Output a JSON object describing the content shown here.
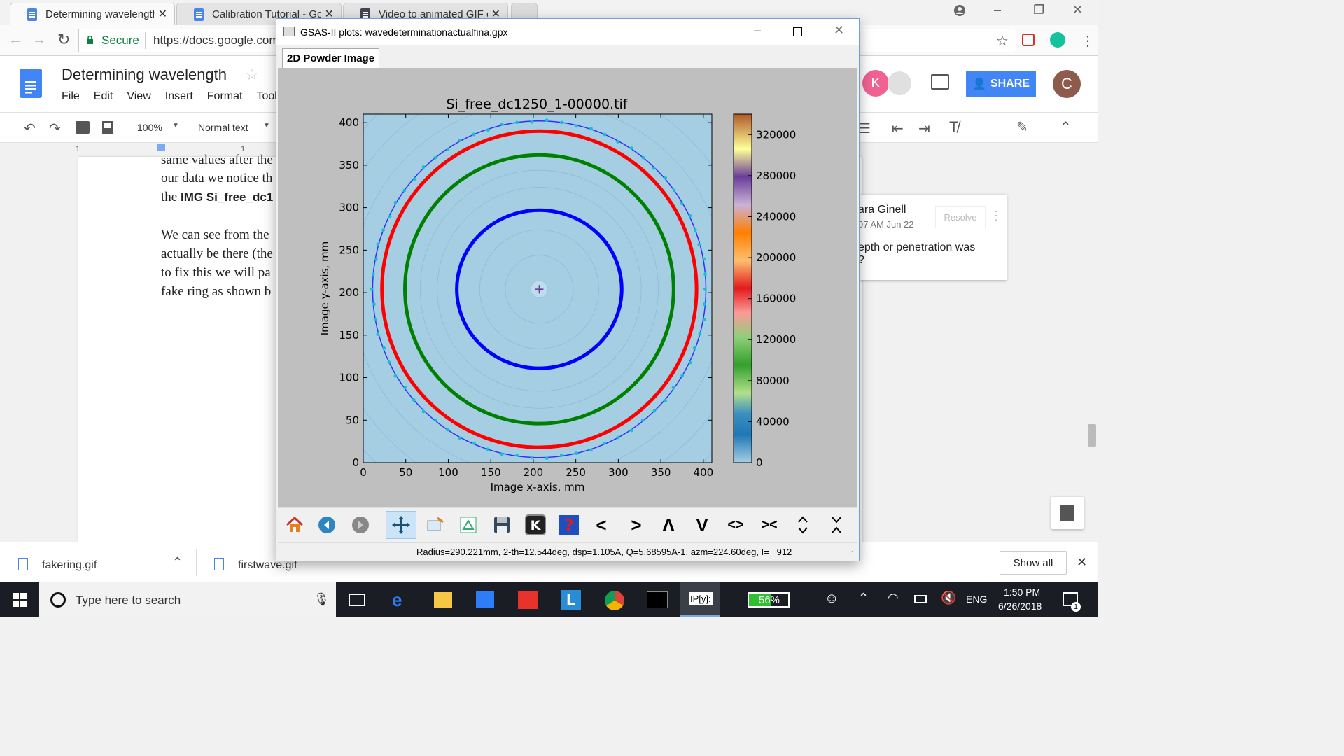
{
  "browser": {
    "tabs": [
      {
        "title": "Determining wavelength",
        "active": true
      },
      {
        "title": "Calibration Tutorial - Goo",
        "active": false
      },
      {
        "title": "Video to animated GIF co",
        "active": false
      }
    ],
    "secure_label": "Secure",
    "url": "https://docs.google.com"
  },
  "docs": {
    "doc_title": "Determining wavelength",
    "menu": [
      "File",
      "Edit",
      "View",
      "Insert",
      "Format",
      "Tool"
    ],
    "zoom": "100%",
    "style": "Normal text",
    "share_label": "SHARE",
    "account_initial": "C",
    "collab_initial": "K",
    "ruler_tick_1": "1",
    "ruler_tick_2": "1",
    "body_lines": [
      "same values after the",
      "our data we notice th",
      "the ",
      "We can see from the",
      "actually be there (the",
      "to fix this we will pa",
      "fake ring as shown b"
    ],
    "body_bold": "IMG Si_free_dc1",
    "comment": {
      "author": "ara Ginell",
      "time": "07 AM Jun 22",
      "resolve_label": "Resolve",
      "text_1": "epth or penetration was",
      "text_2": "?"
    }
  },
  "downloads": {
    "items": [
      "fakering.gif",
      "firstwave.gif"
    ],
    "show_all_label": "Show all"
  },
  "taskbar": {
    "search_placeholder": "Type here to search",
    "battery": "56%",
    "lang": "ENG",
    "time": "1:50 PM",
    "date": "6/26/2018",
    "notif_count": "1",
    "ipy_label": "IP[y]:"
  },
  "gsas": {
    "window_title": "GSAS-II plots: wavedeterminationactualfina.gpx",
    "tab_label": "2D Powder Image",
    "status_text": "Radius=290.221mm, 2-th=12.544deg, dsp=1.105A, Q=5.68595A-1, azm=224.60deg, I=   912",
    "toolbar_glyphs": [
      "<",
      ">",
      "Λ",
      "V",
      "<>",
      "><"
    ]
  },
  "chart_data": {
    "type": "heatmap",
    "title": "Si_free_dc1250_1-00000.tif",
    "xlabel": "Image x-axis, mm",
    "ylabel": "Image y-axis, mm",
    "xlim": [
      0,
      410
    ],
    "ylim": [
      0,
      410
    ],
    "xticks": [
      0,
      50,
      100,
      150,
      200,
      250,
      300,
      350,
      400
    ],
    "yticks": [
      0,
      50,
      100,
      150,
      200,
      250,
      300,
      350,
      400
    ],
    "beam_center": [
      207,
      204
    ],
    "colorbar": {
      "range": [
        0,
        340000
      ],
      "ticks": [
        0,
        40000,
        80000,
        120000,
        160000,
        200000,
        240000,
        280000,
        320000
      ],
      "colormap": "Paired-like (blue-green-red-orange-purple-yellow-brown)"
    },
    "rings": [
      {
        "name": "blue ring",
        "color": "#0000ff",
        "center": [
          207,
          204
        ],
        "radius_x": 97,
        "radius_y": 93
      },
      {
        "name": "green ring",
        "color": "#008000",
        "center": [
          207,
          204
        ],
        "radius_x": 158,
        "radius_y": 158
      },
      {
        "name": "red ring",
        "color": "#ff0000",
        "center": [
          207,
          204
        ],
        "radius_x": 185,
        "radius_y": 186
      },
      {
        "name": "fitted outer ring",
        "color": "#3030ff",
        "center": [
          207,
          204
        ],
        "radius_x": 196,
        "radius_y": 198
      }
    ],
    "background_rings_radii": [
      10,
      40,
      70,
      120,
      140,
      220,
      250,
      280,
      310
    ],
    "outer_ring_points": 70
  },
  "colors": {
    "docs_blue": "#4285f4",
    "share_blue": "#4285f4",
    "plot_bg": "#a6cee3",
    "taskbar": "#1a1d24"
  }
}
